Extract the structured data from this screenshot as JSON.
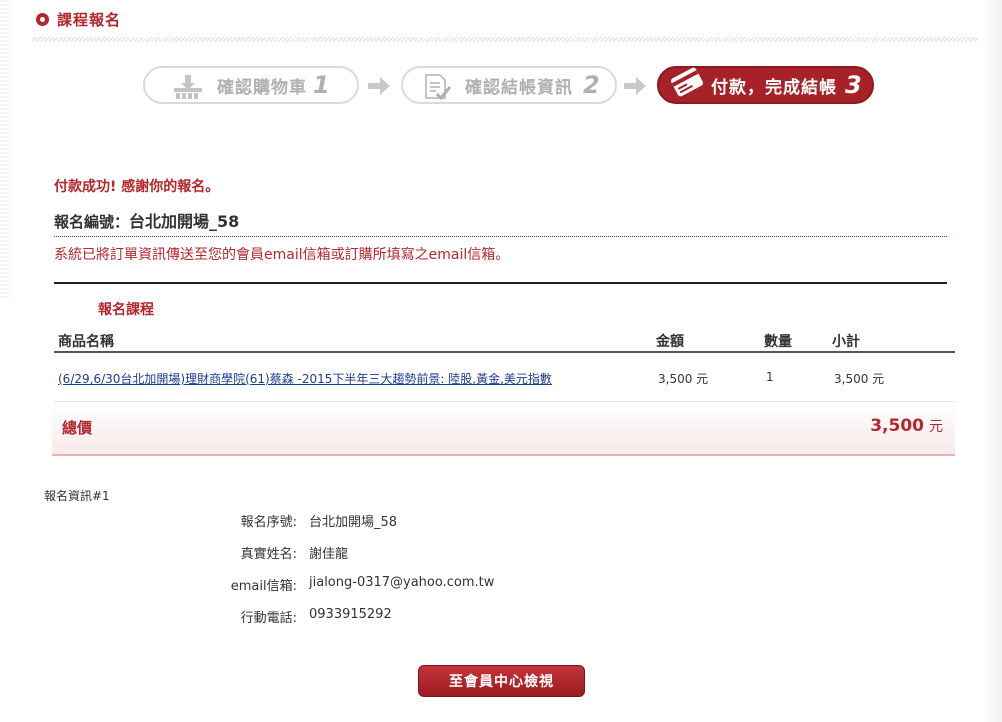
{
  "header": {
    "title": "課程報名"
  },
  "steps": [
    {
      "label": "確認購物車",
      "number": "1",
      "icon": "basket-icon",
      "state": "done"
    },
    {
      "label": "確認結帳資訊",
      "number": "2",
      "icon": "checklist-icon",
      "state": "done"
    },
    {
      "label": "付款，完成結帳",
      "number": "3",
      "icon": "credit-card-icon",
      "state": "active"
    }
  ],
  "result": {
    "success_message": "付款成功! 感謝你的報名。",
    "order_number_label": "報名編號：",
    "order_number_value": "台北加開場_58",
    "email_notice": "系統已將訂單資訊傳送至您的會員email信箱或訂購所填寫之email信箱。"
  },
  "order_table": {
    "section_label": "報名課程",
    "columns": [
      "商品名稱",
      "金額",
      "數量",
      "小計"
    ],
    "rows": [
      {
        "name": "(6/29,6/30台北加開場)理財商學院(61)蔡森 -2015下半年三大趨勢前景: 陸股,黃金,美元指數",
        "price": "3,500 元",
        "quantity": "1",
        "subtotal": "3,500 元"
      }
    ],
    "total_label": "總價",
    "total_amount": "3,500",
    "total_unit": "元"
  },
  "registration": {
    "title": "報名資訊#1",
    "fields": [
      {
        "label": "報名序號:",
        "value": "台北加開場_58"
      },
      {
        "label": "真實姓名:",
        "value": "謝佳龍"
      },
      {
        "label": "email信箱:",
        "value": "jialong-0317@yahoo.com.tw"
      },
      {
        "label": "行動電話:",
        "value": "0933915292"
      }
    ]
  },
  "actions": {
    "member_center_label": "至會員中心檢視"
  },
  "colors": {
    "accent": "#b3282d",
    "link": "#1a3d8f",
    "inactive": "#b0b0b0"
  }
}
